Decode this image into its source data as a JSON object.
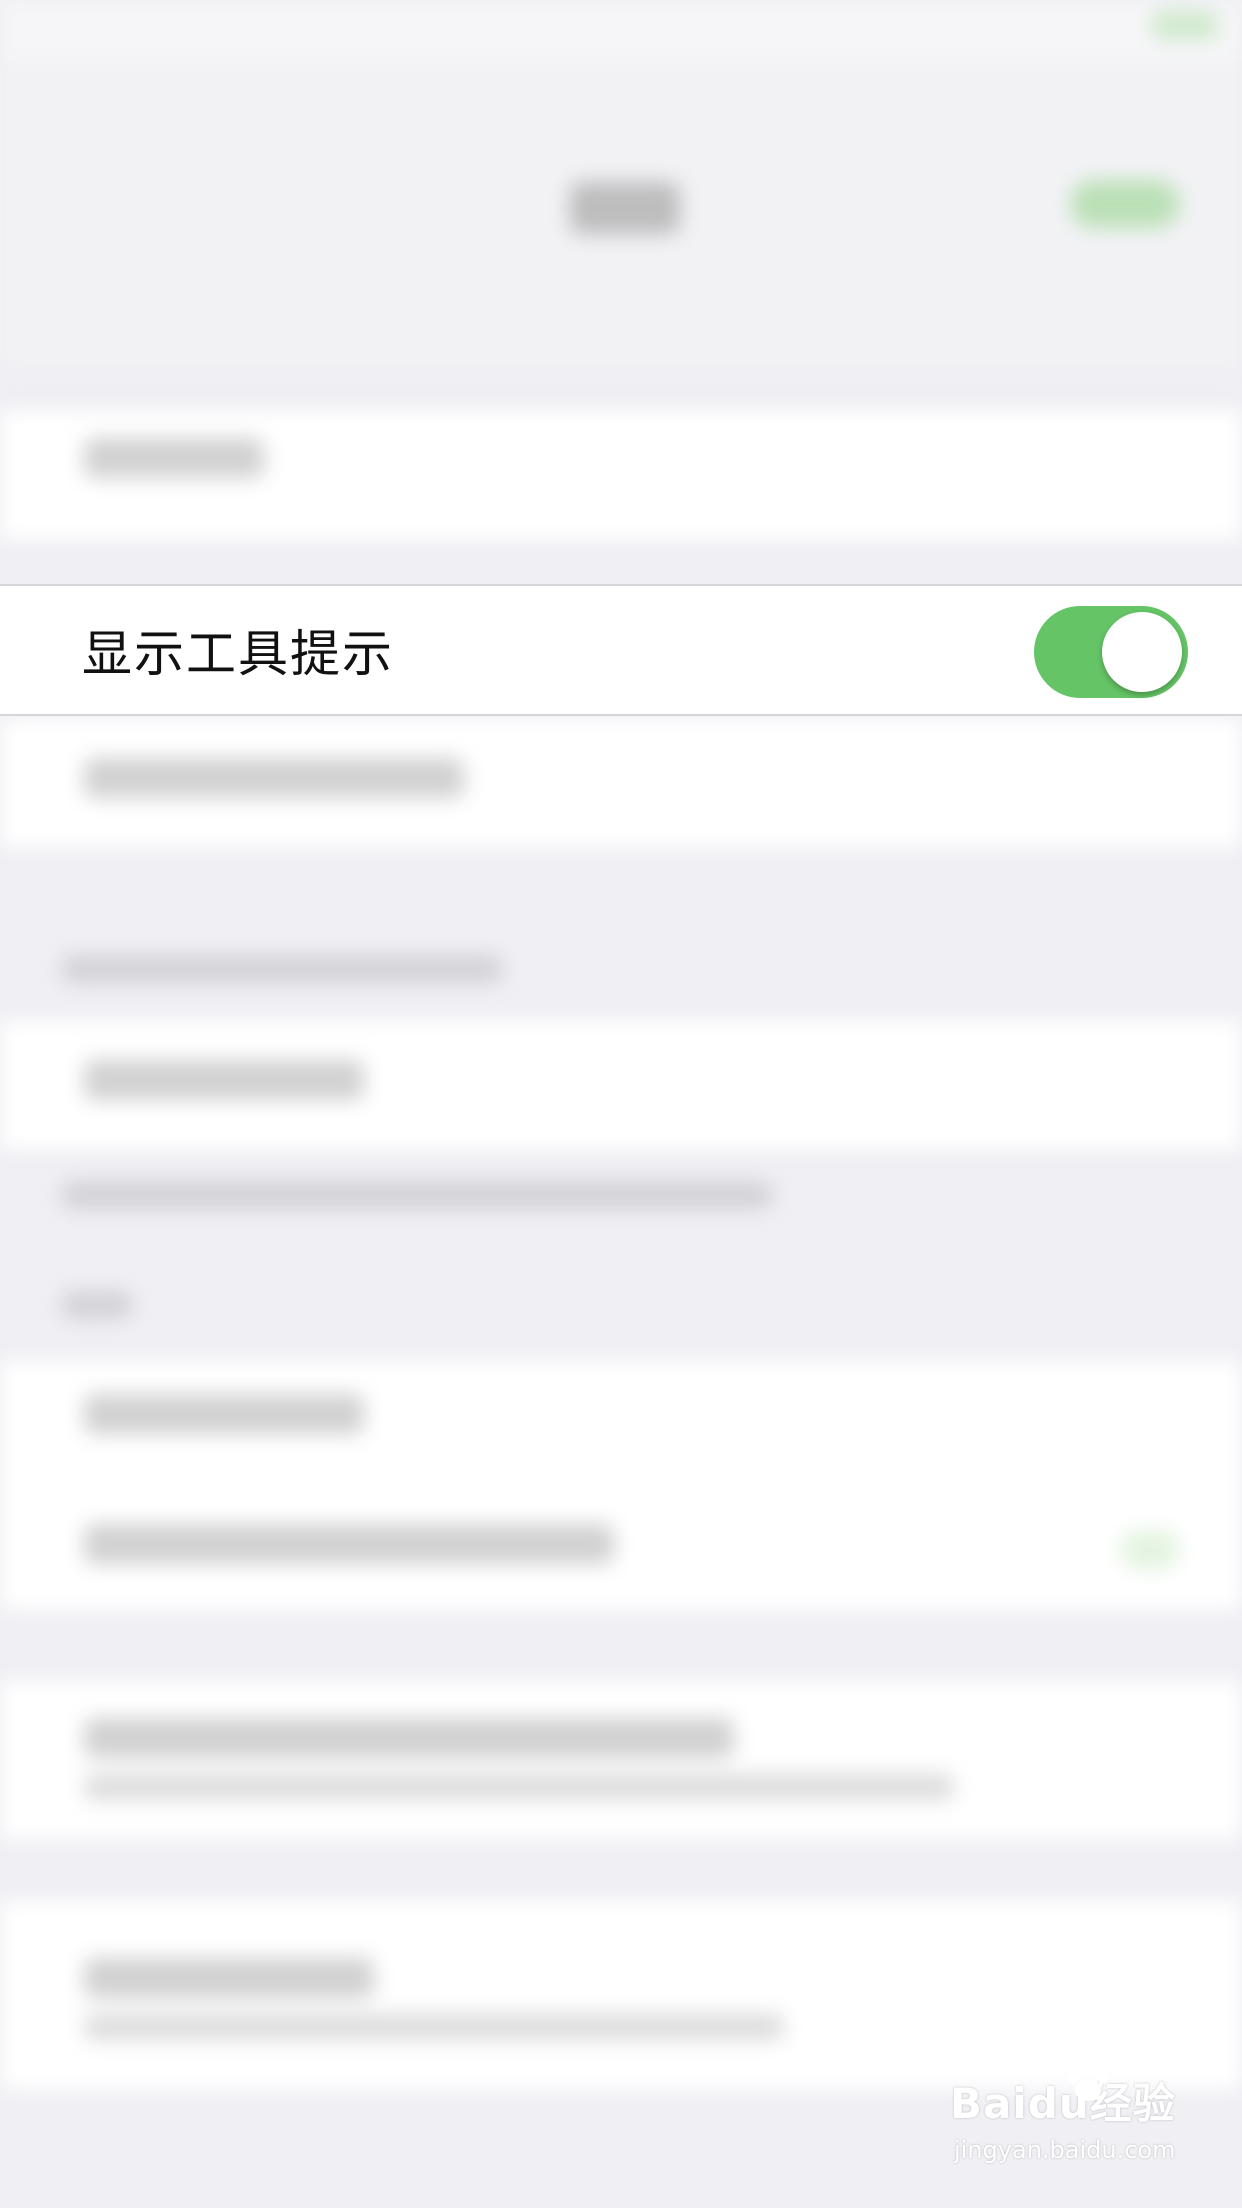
{
  "settings_row": {
    "label": "显示工具提示",
    "toggle_on": true
  },
  "colors": {
    "toggle_on": "#65c466",
    "background": "#efeff4",
    "row_background": "#ffffff"
  },
  "watermark": {
    "brand": "Baidu经验",
    "url": "jingyan.baidu.com"
  }
}
